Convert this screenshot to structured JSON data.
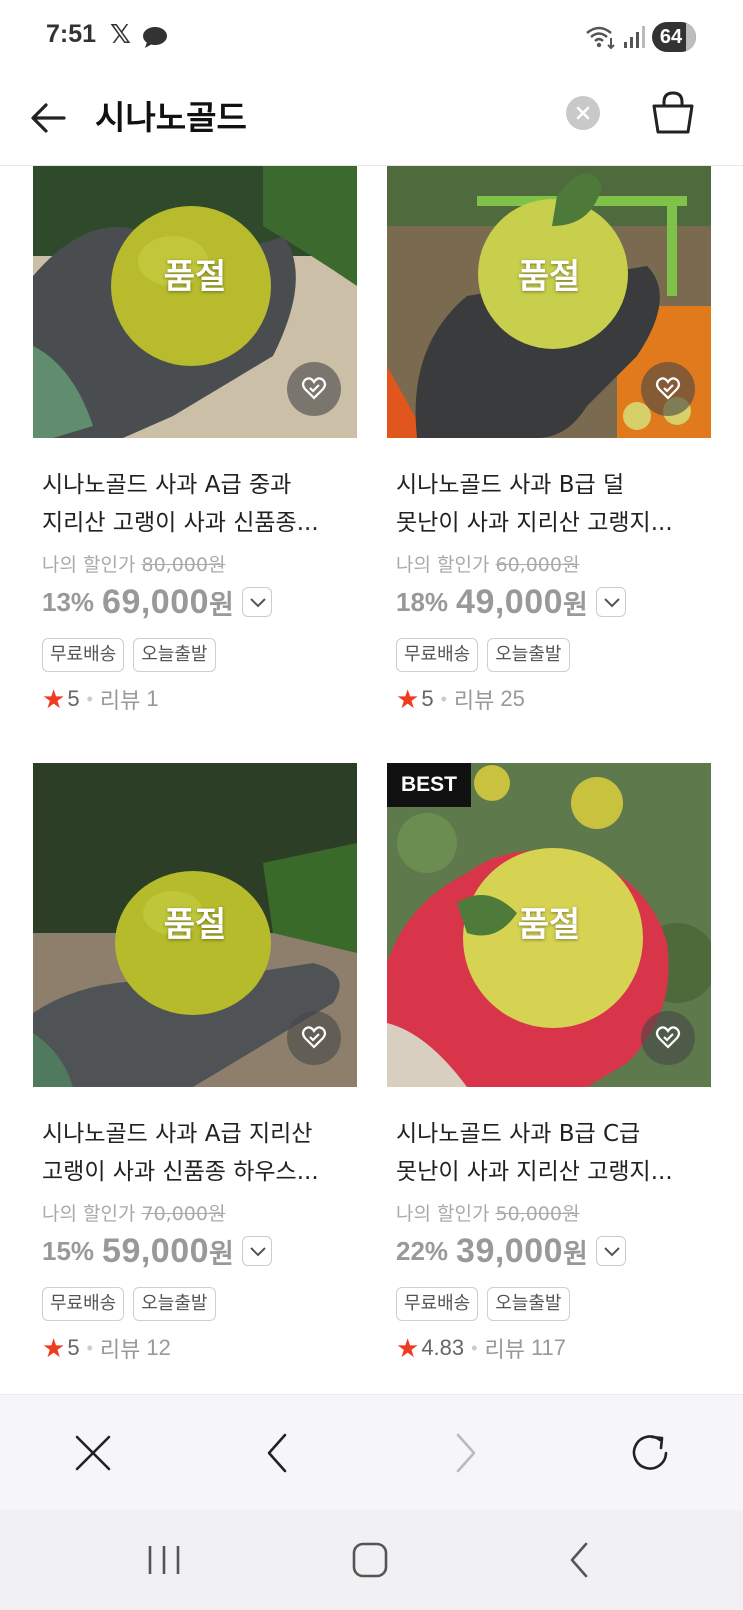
{
  "status_bar": {
    "time": "7:51",
    "x_icon": "𝕏",
    "battery": "64"
  },
  "header": {
    "title": "시나노골드"
  },
  "products": [
    {
      "title_line1": "시나노골드 사과 A급 중과",
      "title_line2": "지리산 고랭이 사과 신품종...",
      "price_label": "나의 할인가",
      "original_price": "80,000원",
      "discount": "13%",
      "price": "69,000",
      "price_unit": "원",
      "tags": [
        "무료배송",
        "오늘출발"
      ],
      "rating": "5",
      "review_label": "리뷰",
      "review_count": "1",
      "sold_out": "품절",
      "best": ""
    },
    {
      "title_line1": "시나노골드 사과 B급 덜",
      "title_line2": "못난이 사과 지리산 고랭지...",
      "price_label": "나의 할인가",
      "original_price": "60,000원",
      "discount": "18%",
      "price": "49,000",
      "price_unit": "원",
      "tags": [
        "무료배송",
        "오늘출발"
      ],
      "rating": "5",
      "review_label": "리뷰",
      "review_count": "25",
      "sold_out": "품절",
      "best": ""
    },
    {
      "title_line1": "시나노골드 사과 A급 지리산",
      "title_line2": "고랭이 사과 신품종 하우스...",
      "price_label": "나의 할인가",
      "original_price": "70,000원",
      "discount": "15%",
      "price": "59,000",
      "price_unit": "원",
      "tags": [
        "무료배송",
        "오늘출발"
      ],
      "rating": "5",
      "review_label": "리뷰",
      "review_count": "12",
      "sold_out": "품절",
      "best": ""
    },
    {
      "title_line1": "시나노골드 사과 B급 C급",
      "title_line2": "못난이 사과 지리산 고랭지...",
      "price_label": "나의 할인가",
      "original_price": "50,000원",
      "discount": "22%",
      "price": "39,000",
      "price_unit": "원",
      "tags": [
        "무료배송",
        "오늘출발"
      ],
      "rating": "4.83",
      "review_label": "리뷰",
      "review_count": "117",
      "sold_out": "품절",
      "best": "BEST"
    }
  ],
  "icons": {
    "back": "arrow-left-icon",
    "clear": "close-circle-icon",
    "cart": "shopping-bag-icon",
    "wish": "heart-check-icon",
    "star": "star-icon",
    "browser_close": "close-icon",
    "browser_back": "chevron-left-icon",
    "browser_forward": "chevron-right-icon",
    "browser_reload": "reload-icon",
    "sys_recents": "recents-icon",
    "sys_home": "home-icon",
    "sys_back": "back-icon"
  },
  "colors": {
    "star": "#ef3b22",
    "best_badge": "#111111",
    "soldout_text": "#ffffff",
    "muted_price": "#999999"
  }
}
